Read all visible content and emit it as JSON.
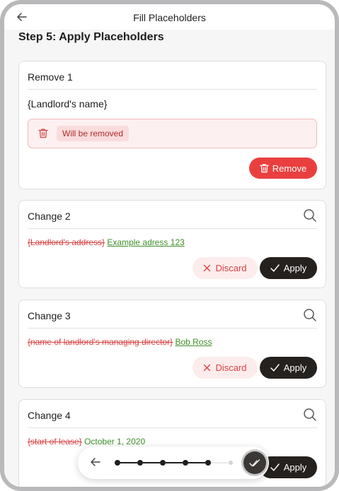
{
  "header": {
    "back_icon": "arrow-left-icon",
    "title": "Fill Placeholders"
  },
  "step_title": "Step 5: Apply Placeholders",
  "remove_card": {
    "title": "Remove 1",
    "placeholder": "{Landlord's name}",
    "badge": "Will be removed",
    "remove_label": "Remove"
  },
  "changes": [
    {
      "title": "Change 2",
      "old_text": "{Landlord's address}",
      "new_text": "Example adress 123",
      "discard_label": "Discard",
      "apply_label": "Apply"
    },
    {
      "title": "Change 3",
      "old_text": "{name of landlord's managing director}",
      "new_text": "Bob Ross",
      "discard_label": "Discard",
      "apply_label": "Apply"
    },
    {
      "title": "Change 4",
      "old_text": "{start of lease}",
      "new_text": "October 1, 2020",
      "apply_label": "Apply"
    }
  ],
  "stepper": {
    "total_steps": 6,
    "completed_steps": 5
  },
  "colors": {
    "danger": "#ea3f3f",
    "dark": "#25211e",
    "added": "#3f8f29",
    "removed": "#d94242"
  }
}
